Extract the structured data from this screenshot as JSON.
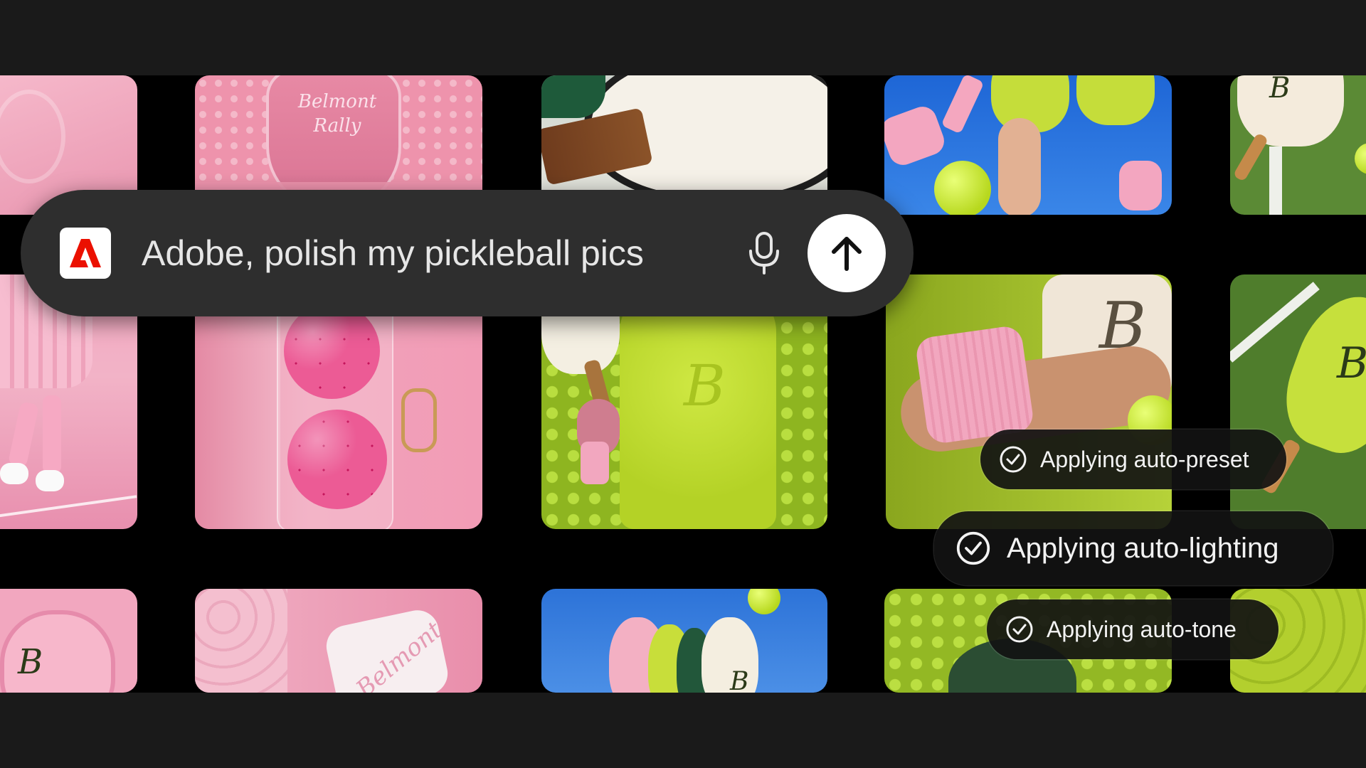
{
  "prompt": {
    "text": "Adobe, polish my pickleball pics",
    "logo_icon": "adobe-logo-icon",
    "mic_icon": "microphone-icon",
    "send_icon": "arrow-up-icon"
  },
  "tiles": {
    "bag_text": "Belmont\nRally",
    "monogram": "B",
    "wristband_text": "Belmont"
  },
  "status": [
    {
      "label": "Applying auto-preset",
      "icon": "check-circle-icon"
    },
    {
      "label": "Applying auto-lighting",
      "icon": "check-circle-icon"
    },
    {
      "label": "Applying auto-tone",
      "icon": "check-circle-icon"
    }
  ],
  "colors": {
    "background": "#1a1a1a",
    "bar": "#2e2e2e",
    "adobe_red": "#eb1000",
    "pink": "#f0a6bd",
    "lime": "#c3e23a"
  }
}
